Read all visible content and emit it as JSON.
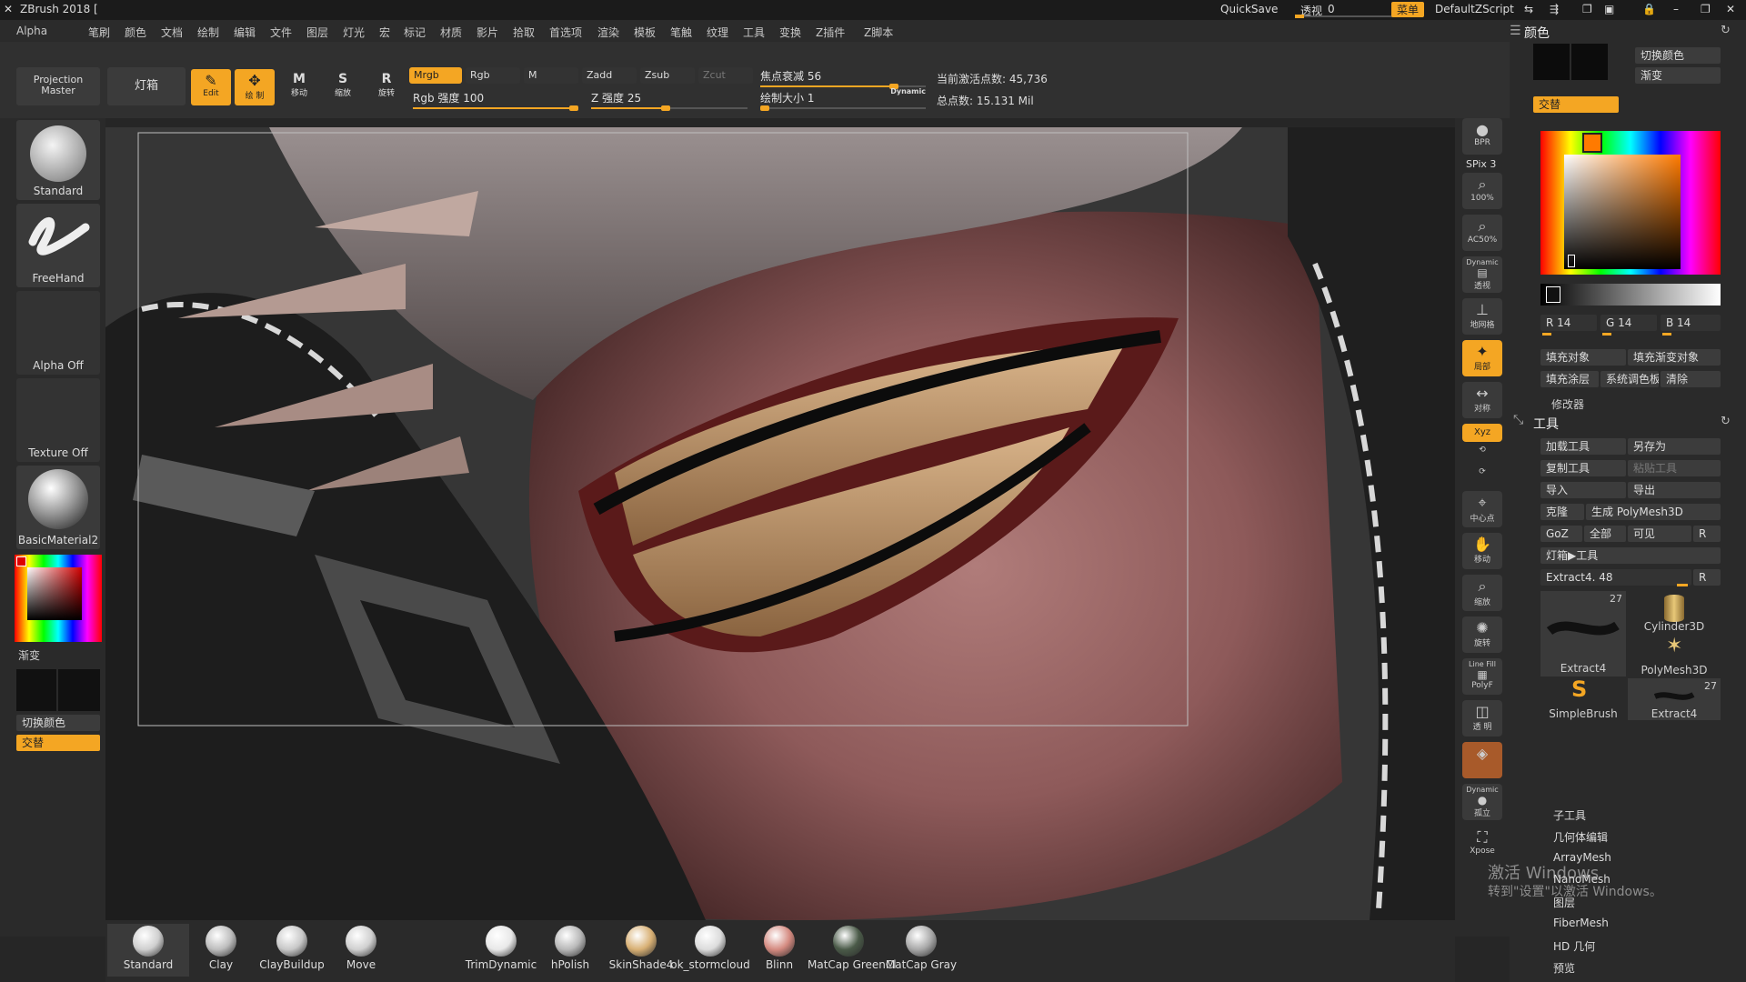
{
  "app": {
    "title": "ZBrush 2018 [",
    "quicksave": "QuickSave",
    "transparency_label": "透视",
    "transparency_value": "0",
    "menu_label": "菜单",
    "script_name": "DefaultZScript"
  },
  "menu": [
    "Alpha",
    "笔刷",
    "颜色",
    "文档",
    "绘制",
    "编辑",
    "文件",
    "图层",
    "灯光",
    "宏",
    "标记",
    "材质",
    "影片",
    "拾取",
    "首选项",
    "渲染",
    "模板",
    "笔触",
    "纹理",
    "工具",
    "变换",
    "Z插件",
    "Z脚本"
  ],
  "toolbar": {
    "projection_master": "Projection Master",
    "lightbox": "灯箱",
    "edit": "Edit",
    "draw": "绘 制",
    "move": "移动",
    "scale": "缩放",
    "rotate": "旋转",
    "mrgb": "Mrgb",
    "rgb": "Rgb",
    "m": "M",
    "zadd": "Zadd",
    "zsub": "Zsub",
    "zcut": "Zcut",
    "rgb_intensity": "Rgb 强度 100",
    "z_intensity": "Z 强度 25",
    "focal_shift": "焦点衰减 56",
    "draw_size": "绘制大小 1",
    "dynamic": "Dynamic",
    "active_points": "当前激活点数: 45,736",
    "total_points": "总点数: 15.131 Mil"
  },
  "left_shelf": {
    "brush": "Standard",
    "stroke": "FreeHand",
    "alpha": "Alpha Off",
    "texture": "Texture Off",
    "material": "BasicMaterial2",
    "gradient": "渐变",
    "switch_color": "切换颜色",
    "alternate": "交替"
  },
  "right_shelf": {
    "bpr": "BPR",
    "spix": "SPix 3",
    "zoom100": "100%",
    "ac50": "AC50%",
    "dynamic": "Dynamic",
    "persp": "透视",
    "floor": "地网格",
    "local": "局部",
    "sym": "对称",
    "xyz": "Xyz",
    "frame": "中心点",
    "move": "移动",
    "scale": "缩放",
    "rotate": "旋转",
    "linefill": "Line Fill",
    "polyf": "PolyF",
    "transp": "透 明",
    "solo": "Dynamic",
    "solo2": "孤立",
    "xpose": "Xpose"
  },
  "right_panel": {
    "color_title": "颜色",
    "switch_color": "切换颜色",
    "gradient": "渐变",
    "alternate": "交替",
    "r": "R 14",
    "g": "G 14",
    "b": "B 14",
    "fill_object": "填充对象",
    "fill_grad_object": "填充渐变对象",
    "fill_layer": "填充涂层",
    "sys_palette": "系统调色板",
    "clear": "清除",
    "modifiers": "修改器",
    "tool_title": "工具",
    "load_tool": "加载工具",
    "save_as": "另存为",
    "copy_tool": "复制工具",
    "paste_tool": "粘贴工具",
    "import": "导入",
    "export": "导出",
    "clone": "克隆",
    "make_polymesh": "生成 PolyMesh3D",
    "goz": "GoZ",
    "all": "全部",
    "visible": "可见",
    "r_btn": "R",
    "lightbox_tools": "灯箱▶工具",
    "current_tool": "Extract4. 48",
    "thumbs": [
      {
        "name": "Extract4",
        "count": "27"
      },
      {
        "name": "Cylinder3D",
        "count": ""
      },
      {
        "name": "PolyMesh3D",
        "count": ""
      },
      {
        "name": "SimpleBrush",
        "count": ""
      },
      {
        "name": "Extract4",
        "count": "27"
      }
    ],
    "sub_items": [
      "子工具",
      "几何体编辑",
      "ArrayMesh",
      "NanoMesh",
      "图层",
      "FiberMesh",
      "HD 几何",
      "预览"
    ]
  },
  "windows_notice": {
    "line1": "激活 Windows",
    "line2": "转到\"设置\"以激活 Windows。"
  },
  "materials": [
    {
      "name": "Standard",
      "color": "#cfcfcf"
    },
    {
      "name": "Clay",
      "color": "#bdbdbd"
    },
    {
      "name": "ClayBuildup",
      "color": "#c8c8c8"
    },
    {
      "name": "Move",
      "color": "#d0d0d0"
    },
    {
      "name": "TrimDynamic",
      "color": "#e8e8e8"
    },
    {
      "name": "hPolish",
      "color": "#b8b8b8"
    },
    {
      "name": "SkinShade4",
      "color": "#d8b074"
    },
    {
      "name": "ok_stormcloud",
      "color": "#dcdcdc"
    },
    {
      "name": "Blinn",
      "color": "#d48a80"
    },
    {
      "name": "MatCap GreenCl",
      "color": "#4a5a48"
    },
    {
      "name": "MatCap Gray",
      "color": "#a8a8a8"
    }
  ]
}
